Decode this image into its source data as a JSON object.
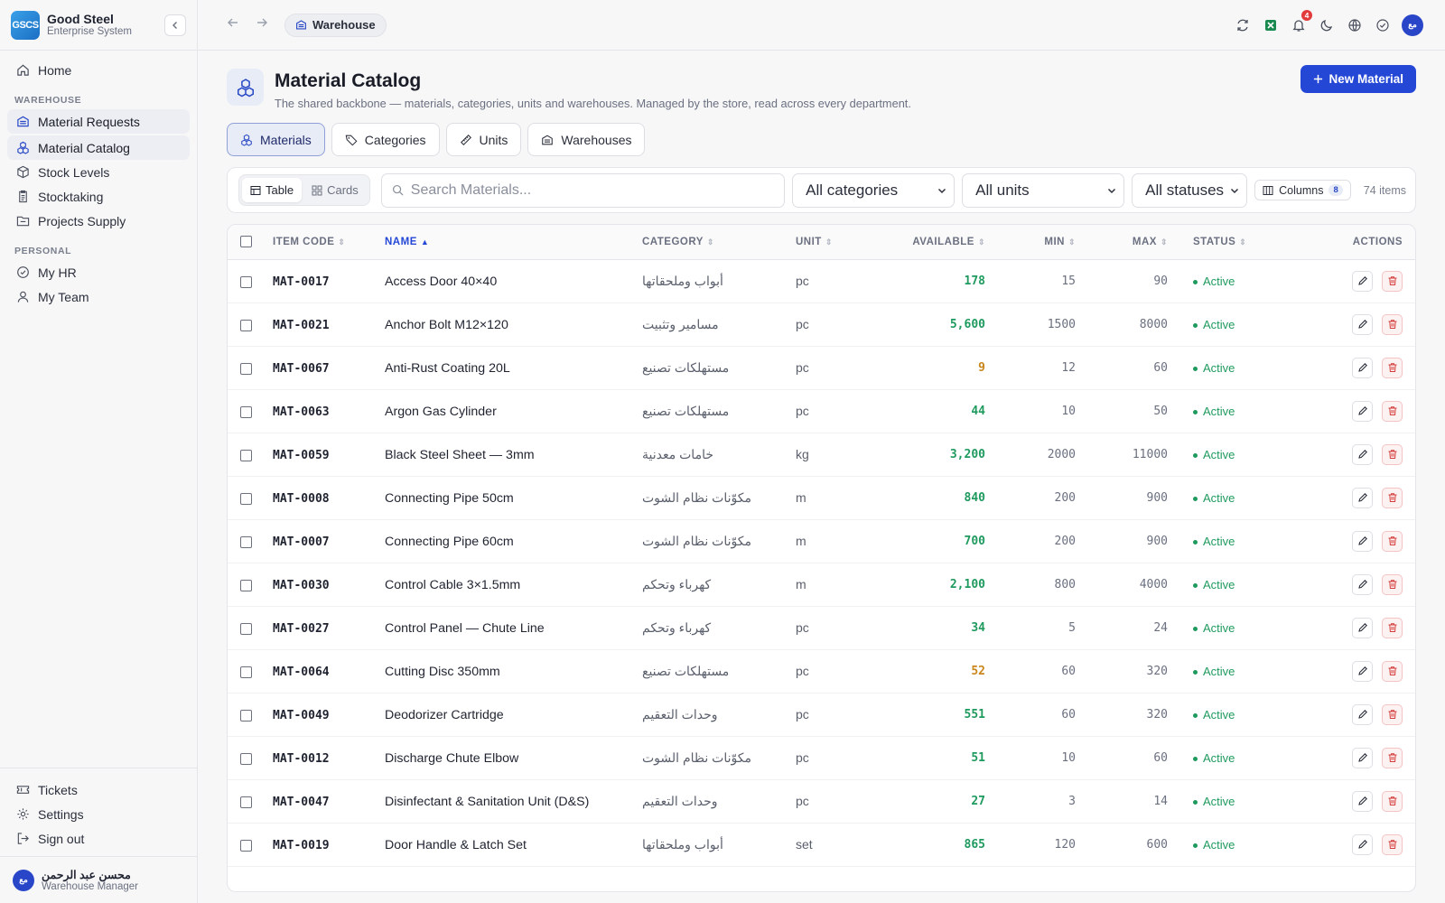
{
  "brand": {
    "logo": "GSCS",
    "name": "Good Steel",
    "sub": "Enterprise System"
  },
  "nav": {
    "home": "Home",
    "section_warehouse": "WAREHOUSE",
    "material_requests": "Material Requests",
    "material_catalog": "Material Catalog",
    "stock_levels": "Stock Levels",
    "stocktaking": "Stocktaking",
    "projects_supply": "Projects Supply",
    "section_personal": "PERSONAL",
    "my_hr": "My HR",
    "my_team": "My Team",
    "tickets": "Tickets",
    "settings": "Settings",
    "sign_out": "Sign out"
  },
  "user": {
    "initials": "مع",
    "name": "محسن عبد الرحمن",
    "role": "Warehouse Manager"
  },
  "topbar": {
    "breadcrumb": "Warehouse",
    "notifications": "4",
    "avatar": "مع"
  },
  "page": {
    "title": "Material Catalog",
    "subtitle": "The shared backbone — materials, categories, units and warehouses. Managed by the store, read across every department.",
    "new_button": "New Material"
  },
  "tabs": [
    "Materials",
    "Categories",
    "Units",
    "Warehouses"
  ],
  "toolbar": {
    "view_table": "Table",
    "view_cards": "Cards",
    "search_placeholder": "Search Materials...",
    "category_filter": "All categories",
    "unit_filter": "All units",
    "status_filter": "All statuses",
    "columns_label": "Columns",
    "columns_count": "8",
    "item_count": "74 items"
  },
  "columns": {
    "code": "ITEM CODE",
    "name": "NAME",
    "category": "CATEGORY",
    "unit": "UNIT",
    "available": "AVAILABLE",
    "min": "MIN",
    "max": "MAX",
    "status": "STATUS",
    "actions": "ACTIONS"
  },
  "colors": {
    "accent": "#2447d6",
    "ok": "#1f9a5e",
    "warn": "#c9861a",
    "danger": "#d43b3b"
  },
  "rows": [
    {
      "code": "MAT-0017",
      "name": "Access Door 40×40",
      "category": "أبواب وملحقاتها",
      "unit": "pc",
      "available": "178",
      "min": "15",
      "max": "90",
      "status": "Active",
      "level": "ok"
    },
    {
      "code": "MAT-0021",
      "name": "Anchor Bolt M12×120",
      "category": "مسامير وتثبيت",
      "unit": "pc",
      "available": "5,600",
      "min": "1500",
      "max": "8000",
      "status": "Active",
      "level": "ok"
    },
    {
      "code": "MAT-0067",
      "name": "Anti-Rust Coating 20L",
      "category": "مستهلكات تصنيع",
      "unit": "pc",
      "available": "9",
      "min": "12",
      "max": "60",
      "status": "Active",
      "level": "warn"
    },
    {
      "code": "MAT-0063",
      "name": "Argon Gas Cylinder",
      "category": "مستهلكات تصنيع",
      "unit": "pc",
      "available": "44",
      "min": "10",
      "max": "50",
      "status": "Active",
      "level": "ok"
    },
    {
      "code": "MAT-0059",
      "name": "Black Steel Sheet — 3mm",
      "category": "خامات معدنية",
      "unit": "kg",
      "available": "3,200",
      "min": "2000",
      "max": "11000",
      "status": "Active",
      "level": "ok"
    },
    {
      "code": "MAT-0008",
      "name": "Connecting Pipe 50cm",
      "category": "مكوّنات نظام الشوت",
      "unit": "m",
      "available": "840",
      "min": "200",
      "max": "900",
      "status": "Active",
      "level": "ok"
    },
    {
      "code": "MAT-0007",
      "name": "Connecting Pipe 60cm",
      "category": "مكوّنات نظام الشوت",
      "unit": "m",
      "available": "700",
      "min": "200",
      "max": "900",
      "status": "Active",
      "level": "ok"
    },
    {
      "code": "MAT-0030",
      "name": "Control Cable 3×1.5mm",
      "category": "كهرباء وتحكم",
      "unit": "m",
      "available": "2,100",
      "min": "800",
      "max": "4000",
      "status": "Active",
      "level": "ok"
    },
    {
      "code": "MAT-0027",
      "name": "Control Panel — Chute Line",
      "category": "كهرباء وتحكم",
      "unit": "pc",
      "available": "34",
      "min": "5",
      "max": "24",
      "status": "Active",
      "level": "ok"
    },
    {
      "code": "MAT-0064",
      "name": "Cutting Disc 350mm",
      "category": "مستهلكات تصنيع",
      "unit": "pc",
      "available": "52",
      "min": "60",
      "max": "320",
      "status": "Active",
      "level": "warn"
    },
    {
      "code": "MAT-0049",
      "name": "Deodorizer Cartridge",
      "category": "وحدات التعقيم",
      "unit": "pc",
      "available": "551",
      "min": "60",
      "max": "320",
      "status": "Active",
      "level": "ok"
    },
    {
      "code": "MAT-0012",
      "name": "Discharge Chute Elbow",
      "category": "مكوّنات نظام الشوت",
      "unit": "pc",
      "available": "51",
      "min": "10",
      "max": "60",
      "status": "Active",
      "level": "ok"
    },
    {
      "code": "MAT-0047",
      "name": "Disinfectant & Sanitation Unit (D&S)",
      "category": "وحدات التعقيم",
      "unit": "pc",
      "available": "27",
      "min": "3",
      "max": "14",
      "status": "Active",
      "level": "ok"
    },
    {
      "code": "MAT-0019",
      "name": "Door Handle & Latch Set",
      "category": "أبواب وملحقاتها",
      "unit": "set",
      "available": "865",
      "min": "120",
      "max": "600",
      "status": "Active",
      "level": "ok"
    }
  ]
}
